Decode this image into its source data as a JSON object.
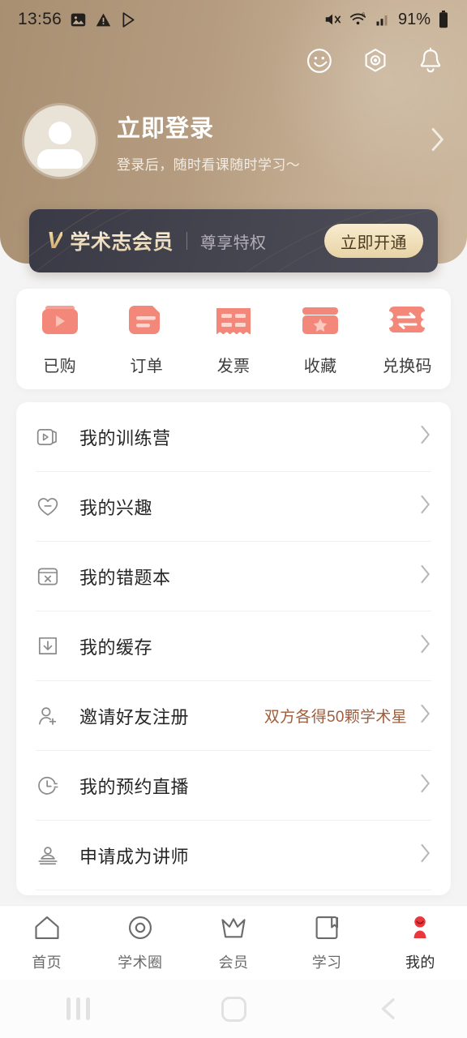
{
  "status_bar": {
    "time": "13:56",
    "left_icons": [
      "image-icon",
      "warning-icon",
      "play-store-icon"
    ],
    "right_icons": [
      "mute-icon",
      "wifi-icon",
      "signal-icon"
    ],
    "battery": "91%"
  },
  "header": {
    "icons": [
      "smiley-icon",
      "hexagon-icon",
      "bell-icon"
    ],
    "login_title": "立即登录",
    "login_subtitle": "登录后，随时看课随时学习～",
    "bg_color": "#b59c80"
  },
  "vip_banner": {
    "logo": "V",
    "title": "学术志会员",
    "subtitle": "尊享特权",
    "button": "立即开通",
    "bg_color": "#44444f",
    "accent_color": "#e8d3a6"
  },
  "quick_actions": [
    {
      "label": "已购",
      "icon": "purchased-video-icon"
    },
    {
      "label": "订单",
      "icon": "order-doc-icon"
    },
    {
      "label": "发票",
      "icon": "invoice-ticket-icon"
    },
    {
      "label": "收藏",
      "icon": "favorite-star-icon"
    },
    {
      "label": "兑换码",
      "icon": "redeem-code-icon"
    }
  ],
  "quick_action_color": "#f3887a",
  "menu": [
    {
      "label": "我的训练营",
      "icon": "video-camp-icon",
      "note": ""
    },
    {
      "label": "我的兴趣",
      "icon": "heart-icon",
      "note": ""
    },
    {
      "label": "我的错题本",
      "icon": "wrong-question-book-icon",
      "note": ""
    },
    {
      "label": "我的缓存",
      "icon": "download-cache-icon",
      "note": ""
    },
    {
      "label": "邀请好友注册",
      "icon": "user-add-icon",
      "note": "双方各得50颗学术星"
    },
    {
      "label": "我的预约直播",
      "icon": "clock-live-icon",
      "note": ""
    },
    {
      "label": "申请成为讲师",
      "icon": "lecturer-icon",
      "note": ""
    }
  ],
  "menu_note_color": "#9e5d3c",
  "tabs": [
    {
      "label": "首页",
      "icon": "home-icon",
      "active": false
    },
    {
      "label": "学术圈",
      "icon": "circle-target-icon",
      "active": false
    },
    {
      "label": "会员",
      "icon": "crown-icon",
      "active": false
    },
    {
      "label": "学习",
      "icon": "book-icon",
      "active": false
    },
    {
      "label": "我的",
      "icon": "profile-person-icon",
      "active": true
    }
  ],
  "tab_active_color": "#e8383d",
  "android_nav": {
    "recents": "recents-icon",
    "home": "home-circle-icon",
    "back": "back-chevron-icon"
  }
}
